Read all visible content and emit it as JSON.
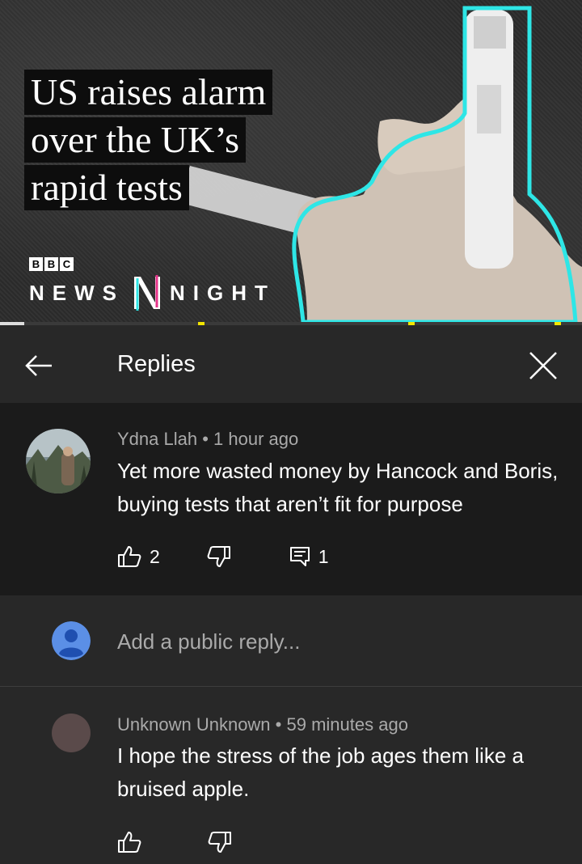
{
  "video": {
    "headline": [
      "US raises alarm",
      "over the UK’s",
      "rapid tests"
    ],
    "brand_letters": [
      "B",
      "B",
      "C"
    ],
    "program_left": "NEWS",
    "program_right": "NIGHT"
  },
  "header": {
    "title": "Replies",
    "back_icon": "arrow-left-icon",
    "close_icon": "close-icon"
  },
  "comment": {
    "author": "Ydna Llah",
    "separator": "•",
    "time": "1 hour ago",
    "text": "Yet more wasted money by Hancock and Boris, buying tests that aren’t fit for purpose",
    "likes": "2",
    "replies": "1"
  },
  "reply_input": {
    "placeholder": "Add a public reply..."
  },
  "replies": [
    {
      "author": "Unknown Unknown",
      "separator": "•",
      "time": "59 minutes ago",
      "text": "I hope the stress of the job ages them like a bruised apple."
    }
  ],
  "colors": {
    "accent_cyan": "#2ee6e6",
    "progress_marker": "#f2e500",
    "avatar_blue": "#5b8fe6"
  }
}
